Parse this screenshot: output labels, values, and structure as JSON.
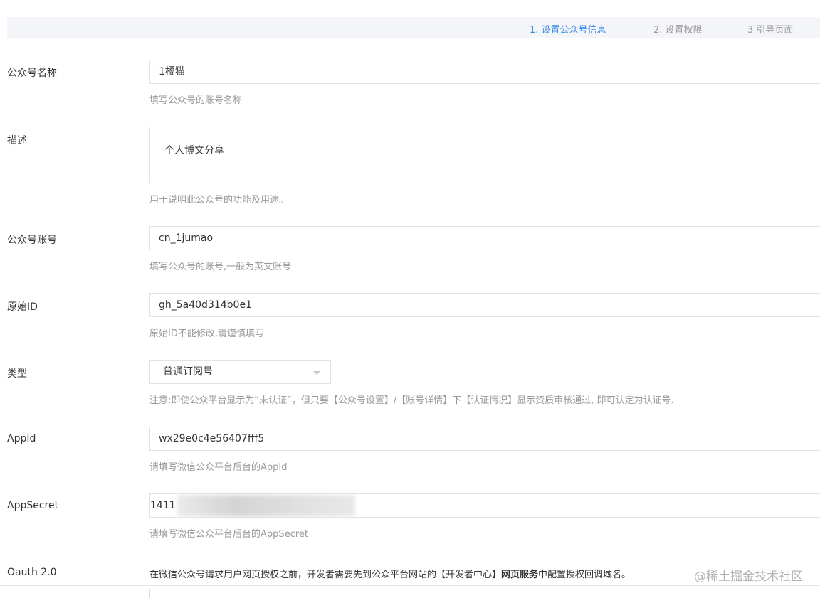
{
  "steps": [
    {
      "label": "1. 设置公众号信息"
    },
    {
      "label": "2. 设置权限"
    },
    {
      "label": "3 引导页面"
    }
  ],
  "colors": {
    "active_step": "#3a8ee6",
    "hint": "#999999",
    "border": "#e3e3e3"
  },
  "form": {
    "name": {
      "label": "公众号名称",
      "value": "1橘猫",
      "hint": "填写公众号的账号名称"
    },
    "description": {
      "label": "描述",
      "value": "个人博文分享",
      "hint": "用于说明此公众号的功能及用途。"
    },
    "account": {
      "label": "公众号账号",
      "value": "cn_1jumao",
      "hint": "填写公众号的账号,一般为英文账号"
    },
    "original_id": {
      "label": "原始ID",
      "value": "gh_5a40d314b0e1",
      "hint": "原始ID不能修改,请谨慎填写"
    },
    "type": {
      "label": "类型",
      "value": "普通订阅号",
      "icon": "chevron-down-icon",
      "hint": "注意:即使公众平台显示为“未认证”，但只要【公众号设置】/【账号详情】下【认证情况】显示资质审核通过, 即可认定为认证号."
    },
    "appid": {
      "label": "AppId",
      "value": "wx29e0c4e56407fff5",
      "hint": "请填写微信公众平台后台的AppId"
    },
    "appsecret": {
      "label": "AppSecret",
      "value_visible": "1411",
      "hint": "请填写微信公众平台后台的AppSecret"
    },
    "oauth": {
      "label": "Oauth 2.0",
      "text_before": "在微信公众号请求用户网页授权之前，开发者需要先到公众平台网站的【开发者中心】",
      "text_bold": "网页服务",
      "text_after": "中配置授权回调域名。"
    }
  },
  "watermark": "@稀土掘金技术社区"
}
